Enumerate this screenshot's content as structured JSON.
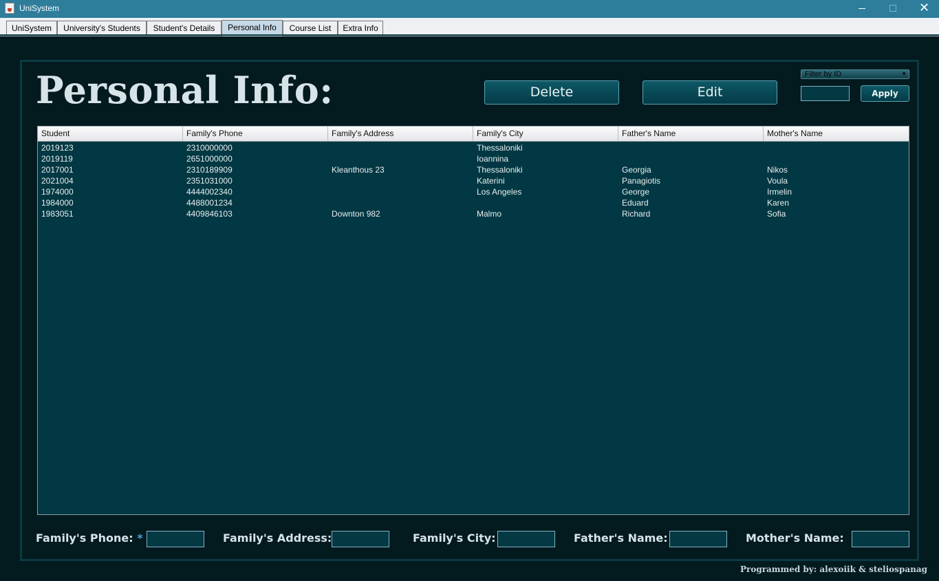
{
  "window": {
    "title": "UniSystem",
    "minimize_glyph": "",
    "close_glyph": "✕"
  },
  "tabs": [
    {
      "label": "UniSystem"
    },
    {
      "label": "University's Students"
    },
    {
      "label": "Student's Details"
    },
    {
      "label": "Personal Info",
      "active": true
    },
    {
      "label": "Course List"
    },
    {
      "label": "Extra Info"
    }
  ],
  "page": {
    "heading": "Personal Info:",
    "delete_label": "Delete",
    "edit_label": "Edit",
    "filter_label": "Filter by ID",
    "filter_id_value": "",
    "apply_label": "Apply"
  },
  "table": {
    "columns": [
      "Student",
      "Family's Phone",
      "Family's Address",
      "Family's City",
      "Father's Name",
      "Mother's Name"
    ],
    "rows": [
      [
        "2019123",
        "2310000000",
        "",
        "Thessaloniki",
        "",
        ""
      ],
      [
        "2019119",
        "2651000000",
        "",
        "Ioannina",
        "",
        ""
      ],
      [
        "2017001",
        "2310189909",
        "Kleanthous 23",
        "Thessaloniki",
        "Georgia",
        "Nikos"
      ],
      [
        "2021004",
        "2351031000",
        "",
        "Katerini",
        "Panagiotis",
        "Voula"
      ],
      [
        "1974000",
        "4444002340",
        "",
        "Los Angeles",
        "George",
        "Irmelin"
      ],
      [
        "1984000",
        "4488001234",
        "",
        "",
        "Eduard",
        "Karen"
      ],
      [
        "1983051",
        "4409846103",
        "Downton 982",
        "Malmo",
        "Richard",
        "Sofia"
      ]
    ]
  },
  "form": {
    "phone_label": "Family's Phone:",
    "phone_required_mark": "*",
    "phone_value": "",
    "address_label": "Family's Address:",
    "address_value": "",
    "city_label": "Family's City:",
    "city_value": "",
    "father_label": "Father's Name:",
    "father_value": "",
    "mother_label": "Mother's Name:",
    "mother_value": ""
  },
  "footer": {
    "credits": "Programmed by: alexoiik & steliospanag"
  },
  "colors": {
    "background": "#031a1e",
    "table_background": "#013843",
    "title_bar": "#2e7d9b",
    "accent": "#3ba6d6"
  },
  "icons": {
    "app": "java-cup-icon",
    "dropdown": "chevron-down-icon"
  }
}
